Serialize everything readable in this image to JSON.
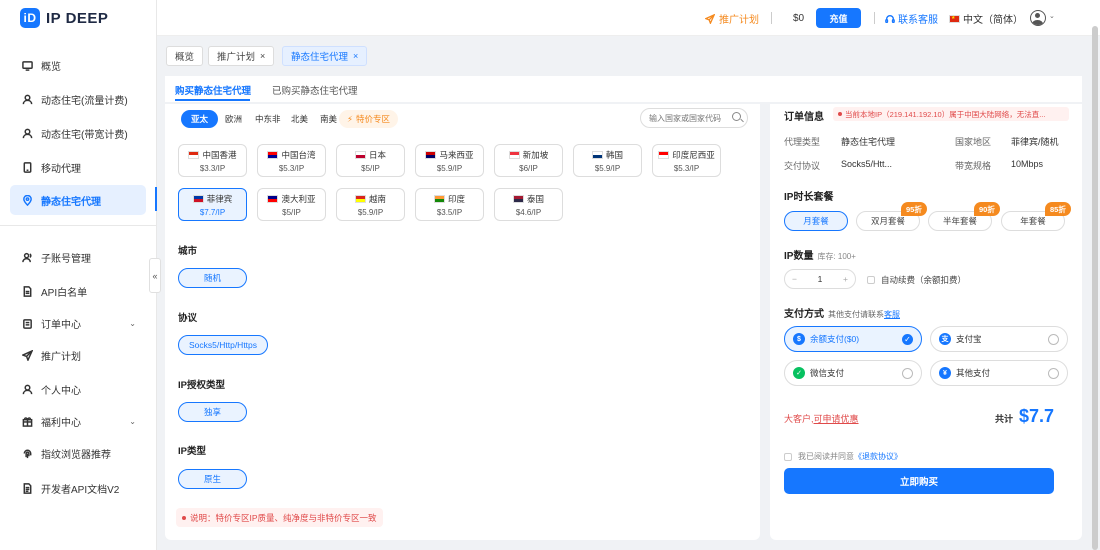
{
  "app": {
    "logo_text": "IP DEEP",
    "logo_mark": "iD"
  },
  "sidebar": {
    "items": [
      {
        "label": "概览",
        "icon": "monitor-icon"
      },
      {
        "label": "动态住宅(流量计费)",
        "icon": "user-icon"
      },
      {
        "label": "动态住宅(带宽计费)",
        "icon": "user-icon"
      },
      {
        "label": "移动代理",
        "icon": "mobile-icon"
      },
      {
        "label": "静态住宅代理",
        "icon": "location-icon"
      },
      {
        "label": "子账号管理",
        "icon": "users-icon"
      },
      {
        "label": "API白名单",
        "icon": "document-icon"
      },
      {
        "label": "订单中心",
        "icon": "clipboard-icon"
      },
      {
        "label": "推广计划",
        "icon": "send-icon"
      },
      {
        "label": "个人中心",
        "icon": "person-icon"
      },
      {
        "label": "福利中心",
        "icon": "gift-icon"
      },
      {
        "label": "指纹浏览器推荐",
        "icon": "fingerprint-icon"
      },
      {
        "label": "开发者API文档V2",
        "icon": "file-icon"
      }
    ],
    "collapse_label": "«"
  },
  "topbar": {
    "promo_label": "推广计划",
    "balance": "$0",
    "recharge_label": "充值",
    "service_label": "联系客服",
    "language": "中文（简体）"
  },
  "tabs": [
    {
      "label": "概览",
      "closable": false
    },
    {
      "label": "推广计划",
      "closable": true
    },
    {
      "label": "静态住宅代理",
      "closable": true
    }
  ],
  "tab_close": "×",
  "subtabs": [
    "购买静态住宅代理",
    "已购买静态住宅代理"
  ],
  "regions": [
    "亚太",
    "欧洲",
    "中东非",
    "北美",
    "南美",
    "特价专区"
  ],
  "search": {
    "placeholder": "输入国家或国家代码"
  },
  "countries": [
    {
      "name": "中国香港",
      "price": "$3.3/IP",
      "colors": [
        "#de2910",
        "#ffffff"
      ]
    },
    {
      "name": "中国台湾",
      "price": "$5.3/IP",
      "colors": [
        "#fe0000",
        "#000095"
      ]
    },
    {
      "name": "日本",
      "price": "$5/IP",
      "colors": [
        "#ffffff",
        "#bc002d"
      ]
    },
    {
      "name": "马来西亚",
      "price": "$5.9/IP",
      "colors": [
        "#cc0001",
        "#010066"
      ]
    },
    {
      "name": "新加坡",
      "price": "$6/IP",
      "colors": [
        "#ef3340",
        "#ffffff"
      ]
    },
    {
      "name": "韩国",
      "price": "$5.9/IP",
      "colors": [
        "#ffffff",
        "#003478"
      ]
    },
    {
      "name": "印度尼西亚",
      "price": "$5.3/IP",
      "colors": [
        "#ff0000",
        "#ffffff"
      ]
    },
    {
      "name": "菲律宾",
      "price": "$7.7/IP",
      "colors": [
        "#0038a8",
        "#ce1126"
      ]
    },
    {
      "name": "澳大利亚",
      "price": "$5/IP",
      "colors": [
        "#00008b",
        "#ff0000"
      ]
    },
    {
      "name": "越南",
      "price": "$5.9/IP",
      "colors": [
        "#da251d",
        "#ffff00"
      ]
    },
    {
      "name": "印度",
      "price": "$3.5/IP",
      "colors": [
        "#ff9933",
        "#138808"
      ]
    },
    {
      "name": "泰国",
      "price": "$4.6/IP",
      "colors": [
        "#a51931",
        "#2d2a4a"
      ]
    }
  ],
  "sections": {
    "city": {
      "title": "城市",
      "option": "随机"
    },
    "protocol": {
      "title": "协议",
      "option": "Socks5/Http/Https"
    },
    "auth": {
      "title": "IP授权类型",
      "option": "独享"
    },
    "iptype": {
      "title": "IP类型",
      "option": "原生"
    }
  },
  "note": "说明：特价专区IP质量、纯净度与非特价专区一致",
  "order": {
    "title": "订单信息",
    "notice": "当前本地IP（219.141.192.10）属于中国大陆网络，无法直...",
    "fields": [
      {
        "k": "代理类型",
        "v": "静态住宅代理"
      },
      {
        "k": "国家地区",
        "v": "菲律宾/随机"
      },
      {
        "k": "交付协议",
        "v": "Socks5/Htt..."
      },
      {
        "k": "带宽规格",
        "v": "10Mbps"
      }
    ],
    "plan_title": "IP时长套餐",
    "plans": [
      {
        "label": "月套餐",
        "discount": ""
      },
      {
        "label": "双月套餐",
        "discount": "95折"
      },
      {
        "label": "半年套餐",
        "discount": "90折"
      },
      {
        "label": "年套餐",
        "discount": "85折"
      }
    ],
    "qty_title": "IP数量",
    "stock": "库存: 100+",
    "qty_minus": "−",
    "qty": "1",
    "qty_plus": "+",
    "auto_renew": "自动续费（余额扣费）",
    "pay_title": "支付方式",
    "pay_hint": "其他支付请联系",
    "pay_hint_link": "客服",
    "payments": [
      {
        "label": "余额支付($0)",
        "color": "#1677ff",
        "glyph": "$"
      },
      {
        "label": "支付宝",
        "color": "#1677ff",
        "glyph": "支"
      },
      {
        "label": "微信支付",
        "color": "#07c160",
        "glyph": "✓"
      },
      {
        "label": "其他支付",
        "color": "#1677ff",
        "glyph": "¥"
      }
    ],
    "check_glyph": "✓",
    "big_customer_prefix": "大客户,",
    "big_customer_link": "可申请优惠",
    "total_label": "共计",
    "total": "$7.7",
    "agree_prefix": "我已阅读并同意",
    "agree_link": "《退款协议》",
    "buy_label": "立即购买"
  }
}
